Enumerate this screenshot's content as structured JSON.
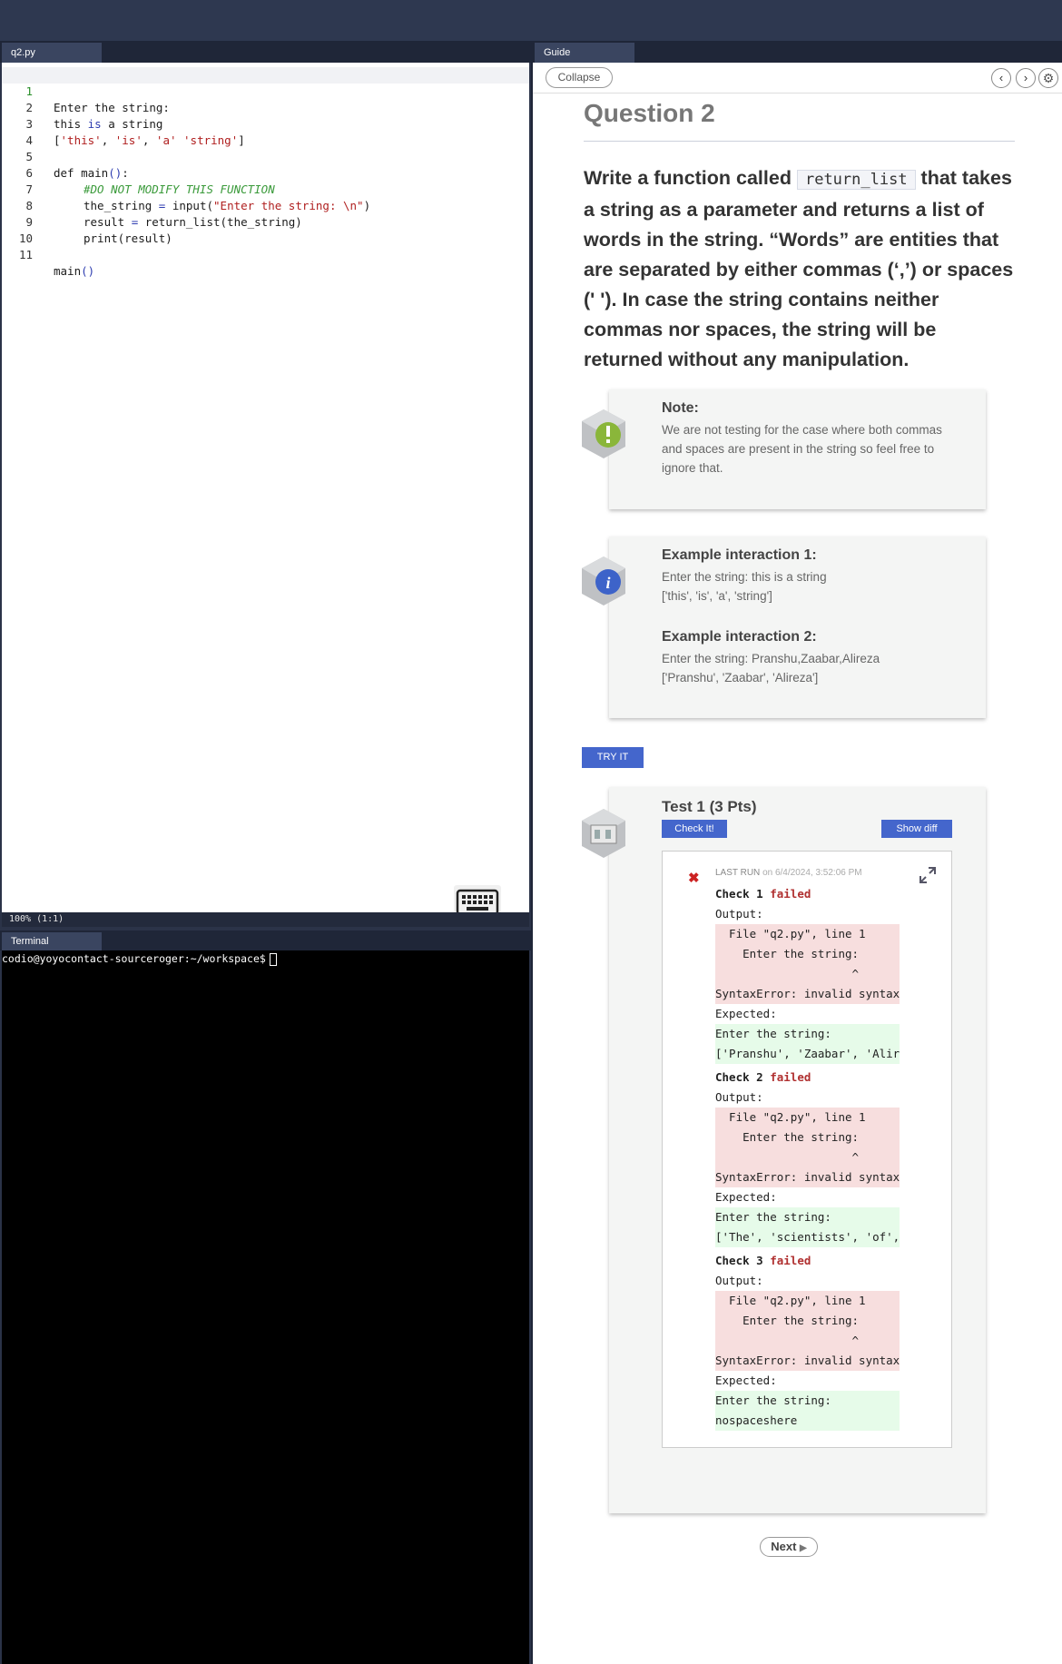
{
  "editor": {
    "tab": "q2.py",
    "lines": [
      {
        "n": "1",
        "text": "Enter the string:"
      },
      {
        "n": "2",
        "text": "this is a string"
      },
      {
        "n": "3",
        "text": "['this', 'is', 'a' 'string']"
      },
      {
        "n": "4",
        "text": ""
      },
      {
        "n": "5",
        "text": "def main():"
      },
      {
        "n": "6",
        "text": "#DO NOT MODIFY THIS FUNCTION"
      },
      {
        "n": "7",
        "text": "the_string = input(\"Enter the string: \\n\")"
      },
      {
        "n": "8",
        "text": "result = return_list(the_string)"
      },
      {
        "n": "9",
        "text": "print(result)"
      },
      {
        "n": "10",
        "text": ""
      },
      {
        "n": "11",
        "text": "main()"
      }
    ],
    "status": "100%  (1:1)"
  },
  "terminal": {
    "tab": "Terminal",
    "prompt": "codio@yoyocontact-sourceroger:~/workspace$"
  },
  "guide": {
    "tab": "Guide",
    "collapse": "Collapse",
    "title": "Question 2",
    "body_before": "Write a function called",
    "inline_code": "return_list",
    "body_after": "that takes a string as a parameter and returns a list of words in the string. “Words” are entities that are separated by either commas (‘,’) or spaces (' '). In case the string contains neither commas nor spaces, the string will be returned without any manipulation.",
    "note": {
      "title": "Note:",
      "text": "We are not testing for the case where both commas and spaces are present in the string so feel free to ignore that."
    },
    "example1": {
      "title": "Example interaction 1:",
      "line1": "Enter the string: this is a string",
      "line2": "['this', 'is', 'a', 'string']"
    },
    "example2": {
      "title": "Example interaction 2:",
      "line1": "Enter the string: Pranshu,Zaabar,Alireza",
      "line2": "['Pranshu', 'Zaabar', 'Alireza']"
    },
    "try_it": "TRY IT",
    "test": {
      "title": "Test 1 (3 Pts)",
      "check_it": "Check It!",
      "show_diff": "Show diff",
      "last_run_label": "LAST RUN",
      "last_run_time": "on 6/4/2024, 3:52:06 PM",
      "failed": "failed",
      "output_label": "Output:",
      "expected_label": "Expected:",
      "checks": [
        {
          "name": "Check 1",
          "out1": "  File \"q2.py\", line 1",
          "out2": "    Enter the string:",
          "out3": "                    ^",
          "out4": "SyntaxError: invalid syntax",
          "exp1": "Enter the string:",
          "exp2": "['Pranshu', 'Zaabar', 'Alir"
        },
        {
          "name": "Check 2",
          "out1": "  File \"q2.py\", line 1",
          "out2": "    Enter the string:",
          "out3": "                    ^",
          "out4": "SyntaxError: invalid syntax",
          "exp1": "Enter the string:",
          "exp2": "['The', 'scientists', 'of',"
        },
        {
          "name": "Check 3",
          "out1": "  File \"q2.py\", line 1",
          "out2": "    Enter the string:",
          "out3": "                    ^",
          "out4": "SyntaxError: invalid syntax",
          "exp1": "Enter the string:",
          "exp2": "nospaceshere"
        }
      ]
    },
    "next": "Next"
  },
  "colors": {
    "accent": "#4466cc",
    "fail": "#b03030",
    "panel_dark": "#1f2638"
  }
}
